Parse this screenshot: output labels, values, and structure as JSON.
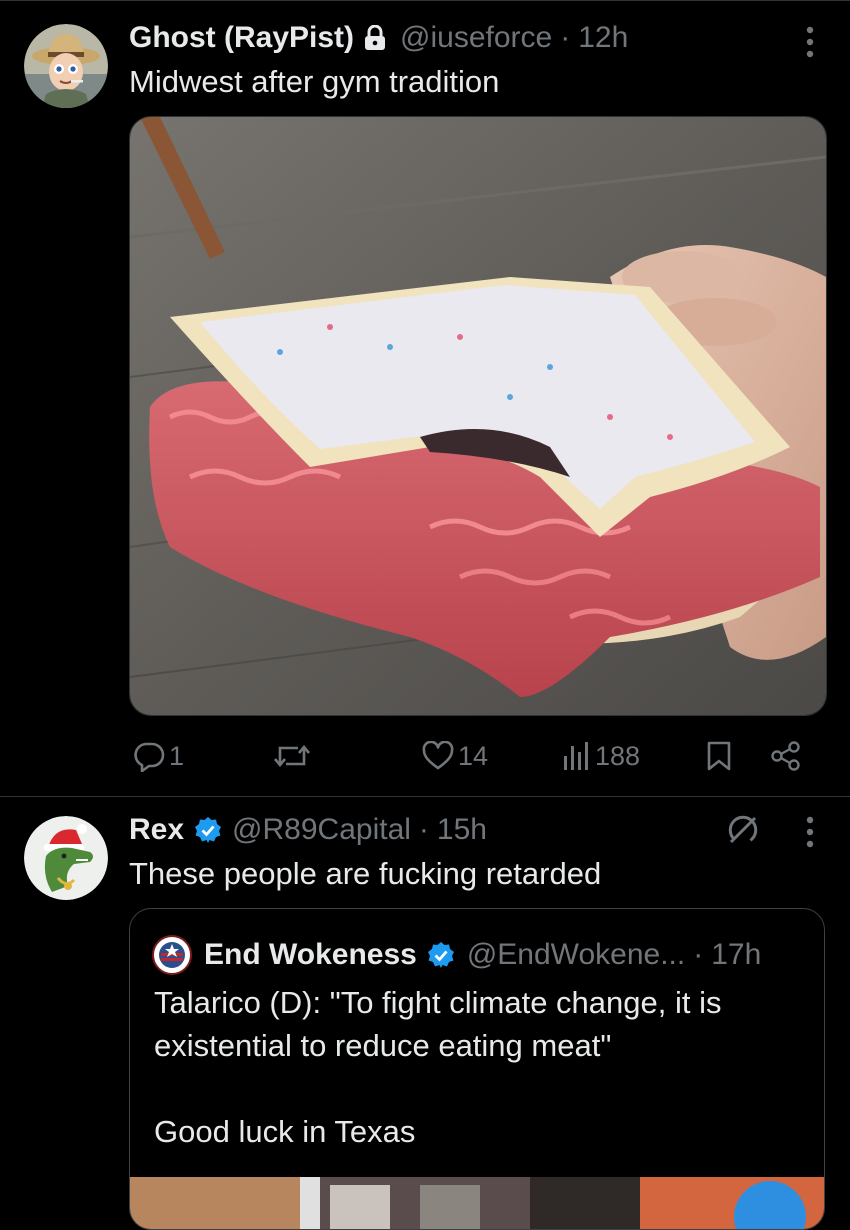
{
  "tweet1": {
    "display_name": "Ghost (RayPist)",
    "handle": "@iuseforce",
    "separator": "·",
    "time": "12h",
    "text": "Midwest after gym tradition",
    "stats": {
      "replies": "1",
      "likes": "14",
      "views": "188"
    }
  },
  "tweet2": {
    "display_name": "Rex",
    "handle": "@R89Capital",
    "separator": "·",
    "time": "15h",
    "text": "These people are fucking retarded",
    "quote": {
      "display_name": "End Wokeness",
      "handle": "@EndWokene...",
      "separator": "·",
      "time": "17h",
      "text": "Talarico (D): \"To fight climate change, it is existential to reduce eating meat\"\n\nGood luck in Texas"
    }
  },
  "colors": {
    "background": "#000000",
    "text": "#e7e9ea",
    "muted": "#71767b",
    "verified": "#1d9bf0",
    "divider": "#2f3336"
  },
  "icons": {
    "lock": "lock-icon",
    "verified": "verified-badge-icon",
    "more": "more-options-icon",
    "reply": "reply-icon",
    "retweet": "retweet-icon",
    "like": "like-icon",
    "views": "views-icon",
    "bookmark": "bookmark-icon",
    "share": "share-icon",
    "grok": "grok-icon"
  }
}
